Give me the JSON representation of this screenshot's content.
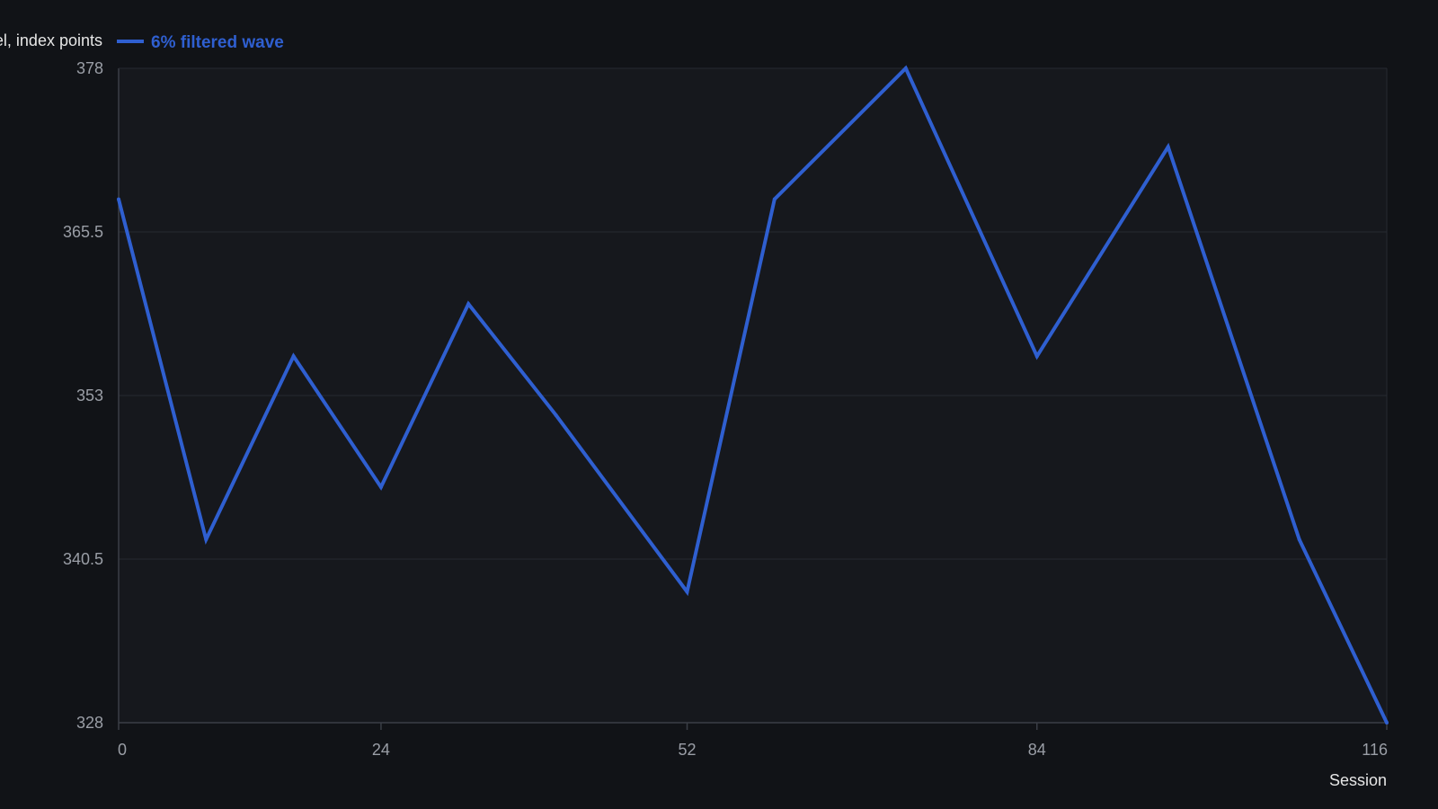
{
  "chart_data": {
    "type": "line",
    "ylabel": "Level, index points",
    "xlabel": "Session",
    "x_ticks": [
      0,
      24,
      52,
      84,
      116
    ],
    "y_ticks": [
      328,
      340.5,
      353,
      365.5,
      378
    ],
    "xlim": [
      0,
      116
    ],
    "ylim": [
      328,
      378
    ],
    "grid": true,
    "legend_position": "top-left",
    "series": [
      {
        "name": "6% filtered wave",
        "color": "#2f5fd0",
        "x": [
          0,
          8,
          16,
          24,
          32,
          40,
          52,
          60,
          72,
          84,
          96,
          108,
          116
        ],
        "y": [
          368,
          342,
          356,
          346,
          360,
          351.5,
          338,
          368,
          378,
          356,
          372,
          342,
          328
        ]
      }
    ]
  },
  "colors": {
    "background": "#111317",
    "plot_background": "#16181d",
    "grid": "#262a31",
    "axis": "#3a3e46",
    "line": "#2f5fd0"
  }
}
